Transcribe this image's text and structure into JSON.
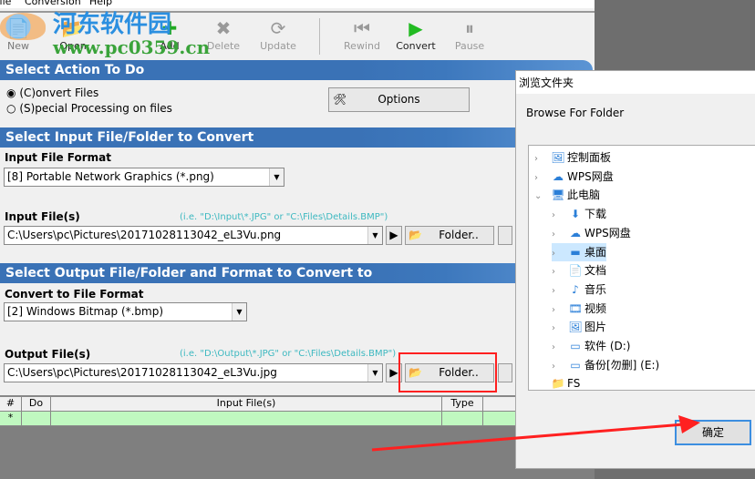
{
  "menu": [
    "File",
    "Conversion",
    "Help"
  ],
  "toolbar": {
    "new": "New",
    "open": "Open",
    "add": "Add",
    "delete": "Delete",
    "update": "Update",
    "rewind": "Rewind",
    "convert": "Convert",
    "pause": "Pause"
  },
  "watermark": {
    "title": "河东软件园",
    "url": "www.pc0359.cn"
  },
  "action": {
    "header": "Select Action To Do",
    "convert": "(C)onvert Files",
    "special": "(S)pecial Processing on files",
    "options": "Options"
  },
  "input": {
    "header": "Select Input File/Folder to Convert",
    "format_label": "Input File Format",
    "format_value": "[8] Portable Network Graphics (*.png)",
    "files_label": "Input File(s)",
    "hint": "(i.e. \"D:\\Input\\*.JPG\" or \"C:\\Files\\Details.BMP\")",
    "path": "C:\\Users\\pc\\Pictures\\20171028113042_eL3Vu.png",
    "folder": "Folder.."
  },
  "output": {
    "header": "Select Output File/Folder and Format to Convert to",
    "format_label": "Convert to File Format",
    "format_value": "[2] Windows Bitmap (*.bmp)",
    "files_label": "Output File(s)",
    "hint": "(i.e. \"D:\\Output\\*.JPG\" or \"C:\\Files\\Details.BMP\")",
    "path": "C:\\Users\\pc\\Pictures\\20171028113042_eL3Vu.jpg",
    "folder": "Folder.."
  },
  "grid": {
    "columns": [
      "#",
      "Do",
      "Input File(s)",
      "Type"
    ],
    "new_row_marker": "*"
  },
  "dialog": {
    "title": "浏览文件夹",
    "prompt": "Browse For Folder",
    "ok": "确定",
    "tree": [
      {
        "label": "控制面板",
        "icon": "control-panel-icon"
      },
      {
        "label": "WPS网盘",
        "icon": "cloud-icon"
      },
      {
        "label": "此电脑",
        "icon": "computer-icon"
      },
      {
        "label": "下载",
        "icon": "download-icon"
      },
      {
        "label": "WPS网盘",
        "icon": "cloud-icon"
      },
      {
        "label": "桌面",
        "icon": "desktop-icon"
      },
      {
        "label": "文档",
        "icon": "document-icon"
      },
      {
        "label": "音乐",
        "icon": "music-icon"
      },
      {
        "label": "视频",
        "icon": "video-icon"
      },
      {
        "label": "图片",
        "icon": "picture-icon"
      },
      {
        "label": "软件 (D:)",
        "icon": "drive-icon"
      },
      {
        "label": "备份[勿删] (E:)",
        "icon": "drive-icon"
      },
      {
        "label": "FS",
        "icon": "folder-icon"
      }
    ]
  },
  "colors": {
    "header_blue": "#3a72b6",
    "grid_new_row": "#c0f8c0",
    "annotation_red": "#ff2020"
  }
}
